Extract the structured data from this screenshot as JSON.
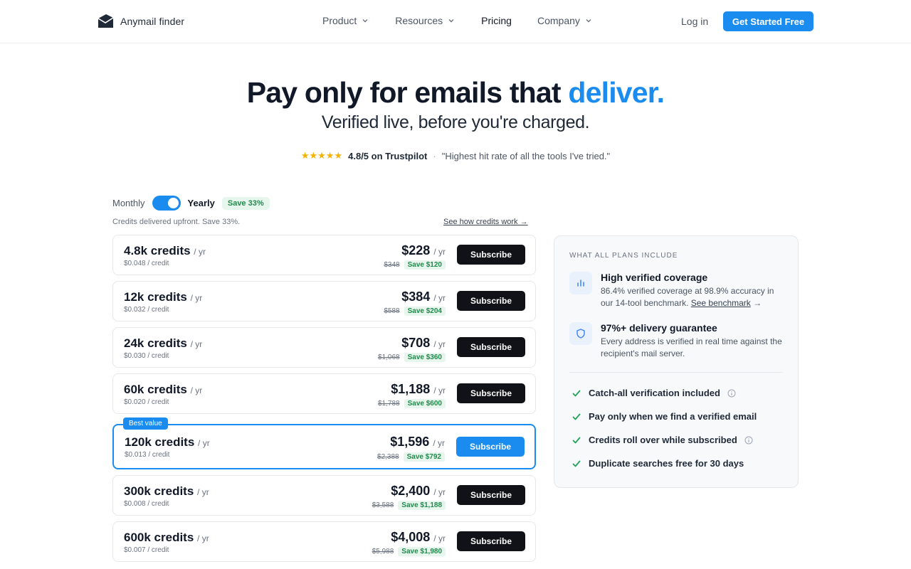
{
  "brand": {
    "name": "Anymail finder"
  },
  "nav": {
    "items": [
      {
        "label": "Product",
        "dropdown": true
      },
      {
        "label": "Resources",
        "dropdown": true
      },
      {
        "label": "Pricing",
        "dropdown": false
      },
      {
        "label": "Company",
        "dropdown": true
      }
    ],
    "login": "Log in",
    "cta": "Get Started Free"
  },
  "hero": {
    "title_main": "Pay only for emails that ",
    "title_accent": "deliver.",
    "subtitle": "Verified live, before you're charged.",
    "stars": "★★★★★",
    "rating": "4.8/5 on Trustpilot",
    "separator": "·",
    "quote": "\"Highest hit rate of all the tools I've tried.\""
  },
  "billing": {
    "monthly": "Monthly",
    "yearly": "Yearly",
    "save_pill": "Save 33%",
    "note": "Credits delivered upfront. Save 33%.",
    "credits_link": "See how credits work →"
  },
  "plans": [
    {
      "credits": "4.8k credits",
      "unit": "/ yr",
      "per_credit": "$0.048 / credit",
      "price": "$228",
      "orig": "$348",
      "save": "Save $120",
      "button": "Subscribe",
      "featured": false
    },
    {
      "credits": "12k credits",
      "unit": "/ yr",
      "per_credit": "$0.032 / credit",
      "price": "$384",
      "orig": "$588",
      "save": "Save $204",
      "button": "Subscribe",
      "featured": false
    },
    {
      "credits": "24k credits",
      "unit": "/ yr",
      "per_credit": "$0.030 / credit",
      "price": "$708",
      "orig": "$1,068",
      "save": "Save $360",
      "button": "Subscribe",
      "featured": false
    },
    {
      "credits": "60k credits",
      "unit": "/ yr",
      "per_credit": "$0.020 / credit",
      "price": "$1,188",
      "orig": "$1,788",
      "save": "Save $600",
      "button": "Subscribe",
      "featured": false
    },
    {
      "credits": "120k credits",
      "unit": "/ yr",
      "per_credit": "$0.013 / credit",
      "price": "$1,596",
      "orig": "$2,388",
      "save": "Save $792",
      "button": "Subscribe",
      "featured": true,
      "badge": "Best value"
    },
    {
      "credits": "300k credits",
      "unit": "/ yr",
      "per_credit": "$0.008 / credit",
      "price": "$2,400",
      "orig": "$3,588",
      "save": "Save $1,188",
      "button": "Subscribe",
      "featured": false
    },
    {
      "credits": "600k credits",
      "unit": "/ yr",
      "per_credit": "$0.007 / credit",
      "price": "$4,008",
      "orig": "$5,988",
      "save": "Save $1,980",
      "button": "Subscribe",
      "featured": false
    }
  ],
  "price_unit": "/ yr",
  "includes": {
    "title": "WHAT ALL PLANS INCLUDE",
    "features": [
      {
        "icon": "bar-chart-icon",
        "title": "High verified coverage",
        "desc": "86.4% verified coverage at 98.9% accuracy in our 14-tool benchmark. ",
        "link": "See benchmark",
        "arrow": "→"
      },
      {
        "icon": "shield-icon",
        "title": "97%+ delivery guarantee",
        "desc": "Every address is verified in real time against the recipient's mail server."
      }
    ],
    "checks": [
      {
        "label": "Catch-all verification included",
        "info": true
      },
      {
        "label": "Pay only when we find a verified email",
        "info": false
      },
      {
        "label": "Credits roll over while subscribed",
        "info": true
      },
      {
        "label": "Duplicate searches free for 30 days",
        "info": false
      }
    ]
  },
  "colors": {
    "accent": "#1a8cf0",
    "success": "#1f8a4c",
    "dark_button": "#101218"
  }
}
